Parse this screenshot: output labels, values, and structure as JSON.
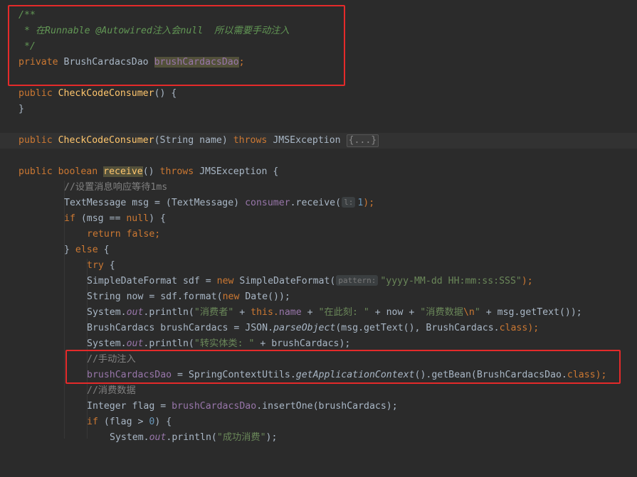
{
  "editor": {
    "lines": {
      "doc_open": "/**",
      "doc_body": " * 在Runnable @Autowired注入会null  所以需要手动注入",
      "doc_close": " */",
      "field_kw": "private",
      "field_type": "BrushCardacsDao",
      "field_name": "brushCardacsDao",
      "semi": ";",
      "ctor1_kw": "public",
      "ctor1_name": "CheckCodeConsumer",
      "ctor1_rest": "() {",
      "close_brace": "}",
      "ctor2_kw": "public",
      "ctor2_name": "CheckCodeConsumer",
      "ctor2_params": "(String name) ",
      "ctor2_throws": "throws",
      "ctor2_exc": " JMSException ",
      "ctor2_fold": "{...}",
      "recv_public": "public",
      "recv_boolean": "boolean",
      "recv_name": "receive",
      "recv_rest": "() ",
      "recv_throws": "throws",
      "recv_exc": " JMSException {",
      "cmt_timeout": "//设置消息响应等待1ms",
      "tm_decl": "TextMessage msg = (TextMessage) ",
      "tm_consumer": "consumer",
      "tm_call": ".receive(",
      "tm_hint": "l:",
      "tm_num": "1",
      "tm_end": ");",
      "if_kw": "if",
      "if_a": " (msg == ",
      "if_null": "null",
      "if_b": ") {",
      "ret_kw": "return false",
      "ret_semi": ";",
      "else_a": "} ",
      "else_kw": "else",
      "else_b": " {",
      "try_kw": "try",
      "try_b": " {",
      "sdf_a": "SimpleDateFormat sdf = ",
      "sdf_new": "new",
      "sdf_b": " SimpleDateFormat(",
      "sdf_hint": "pattern:",
      "sdf_str": "\"yyyy-MM-dd HH:mm:ss:SSS\"",
      "sdf_end": ");",
      "str_a": "String now = sdf.format(",
      "str_new": "new",
      "str_b": " Date());",
      "p1_sys": "System.",
      "p1_out": "out",
      "p1_call": ".println(",
      "p1_s1": "\"消费者\"",
      "p1_plus1": " + ",
      "p1_this": "this",
      "p1_dot": ".",
      "p1_name": "name",
      "p1_plus2": " + ",
      "p1_s2": "\"在此刻: \"",
      "p1_mid": " + now + ",
      "p1_s3": "\"消费数据",
      "p1_esc": "\\n",
      "p1_s3e": "\"",
      "p1_end": " + msg.getText());",
      "bc_a": "BrushCardacs brushCardacs = JSON.",
      "bc_parse": "parseObject",
      "bc_b": "(msg.getText(), BrushCardacs.",
      "bc_class": "class",
      "bc_end": ");",
      "p2_sys": "System.",
      "p2_out": "out",
      "p2_call": ".println(",
      "p2_str": "\"转实体类: \"",
      "p2_end": " + brushCardacs);",
      "cmt_manual": "//手动注入",
      "bean_field": "brushCardacsDao",
      "bean_a": " = SpringContextUtils.",
      "bean_ctx": "getApplicationContext",
      "bean_b": "().getBean(BrushCardacsDao.",
      "bean_class": "class",
      "bean_end": ");",
      "cmt_consume": "//消费数据",
      "int_a": "Integer flag = ",
      "int_field": "brushCardacsDao",
      "int_b": ".insertOne(brushCardacs);",
      "if2_kw": "if",
      "if2_a": " (flag > ",
      "if2_num": "0",
      "if2_b": ") {",
      "last_sys": "System.",
      "last_out": "out",
      "last_call": ".println(",
      "last_str": "\"成功消费\"",
      "last_end": ");"
    }
  },
  "colors": {
    "background": "#2b2b2b",
    "keyword": "#cc7832",
    "string": "#6a8759",
    "comment": "#808080",
    "doc_comment": "#629755",
    "method_decl": "#ffc66d",
    "field": "#9876aa",
    "number": "#6897bb",
    "annotation_box": "#e52a2a"
  }
}
